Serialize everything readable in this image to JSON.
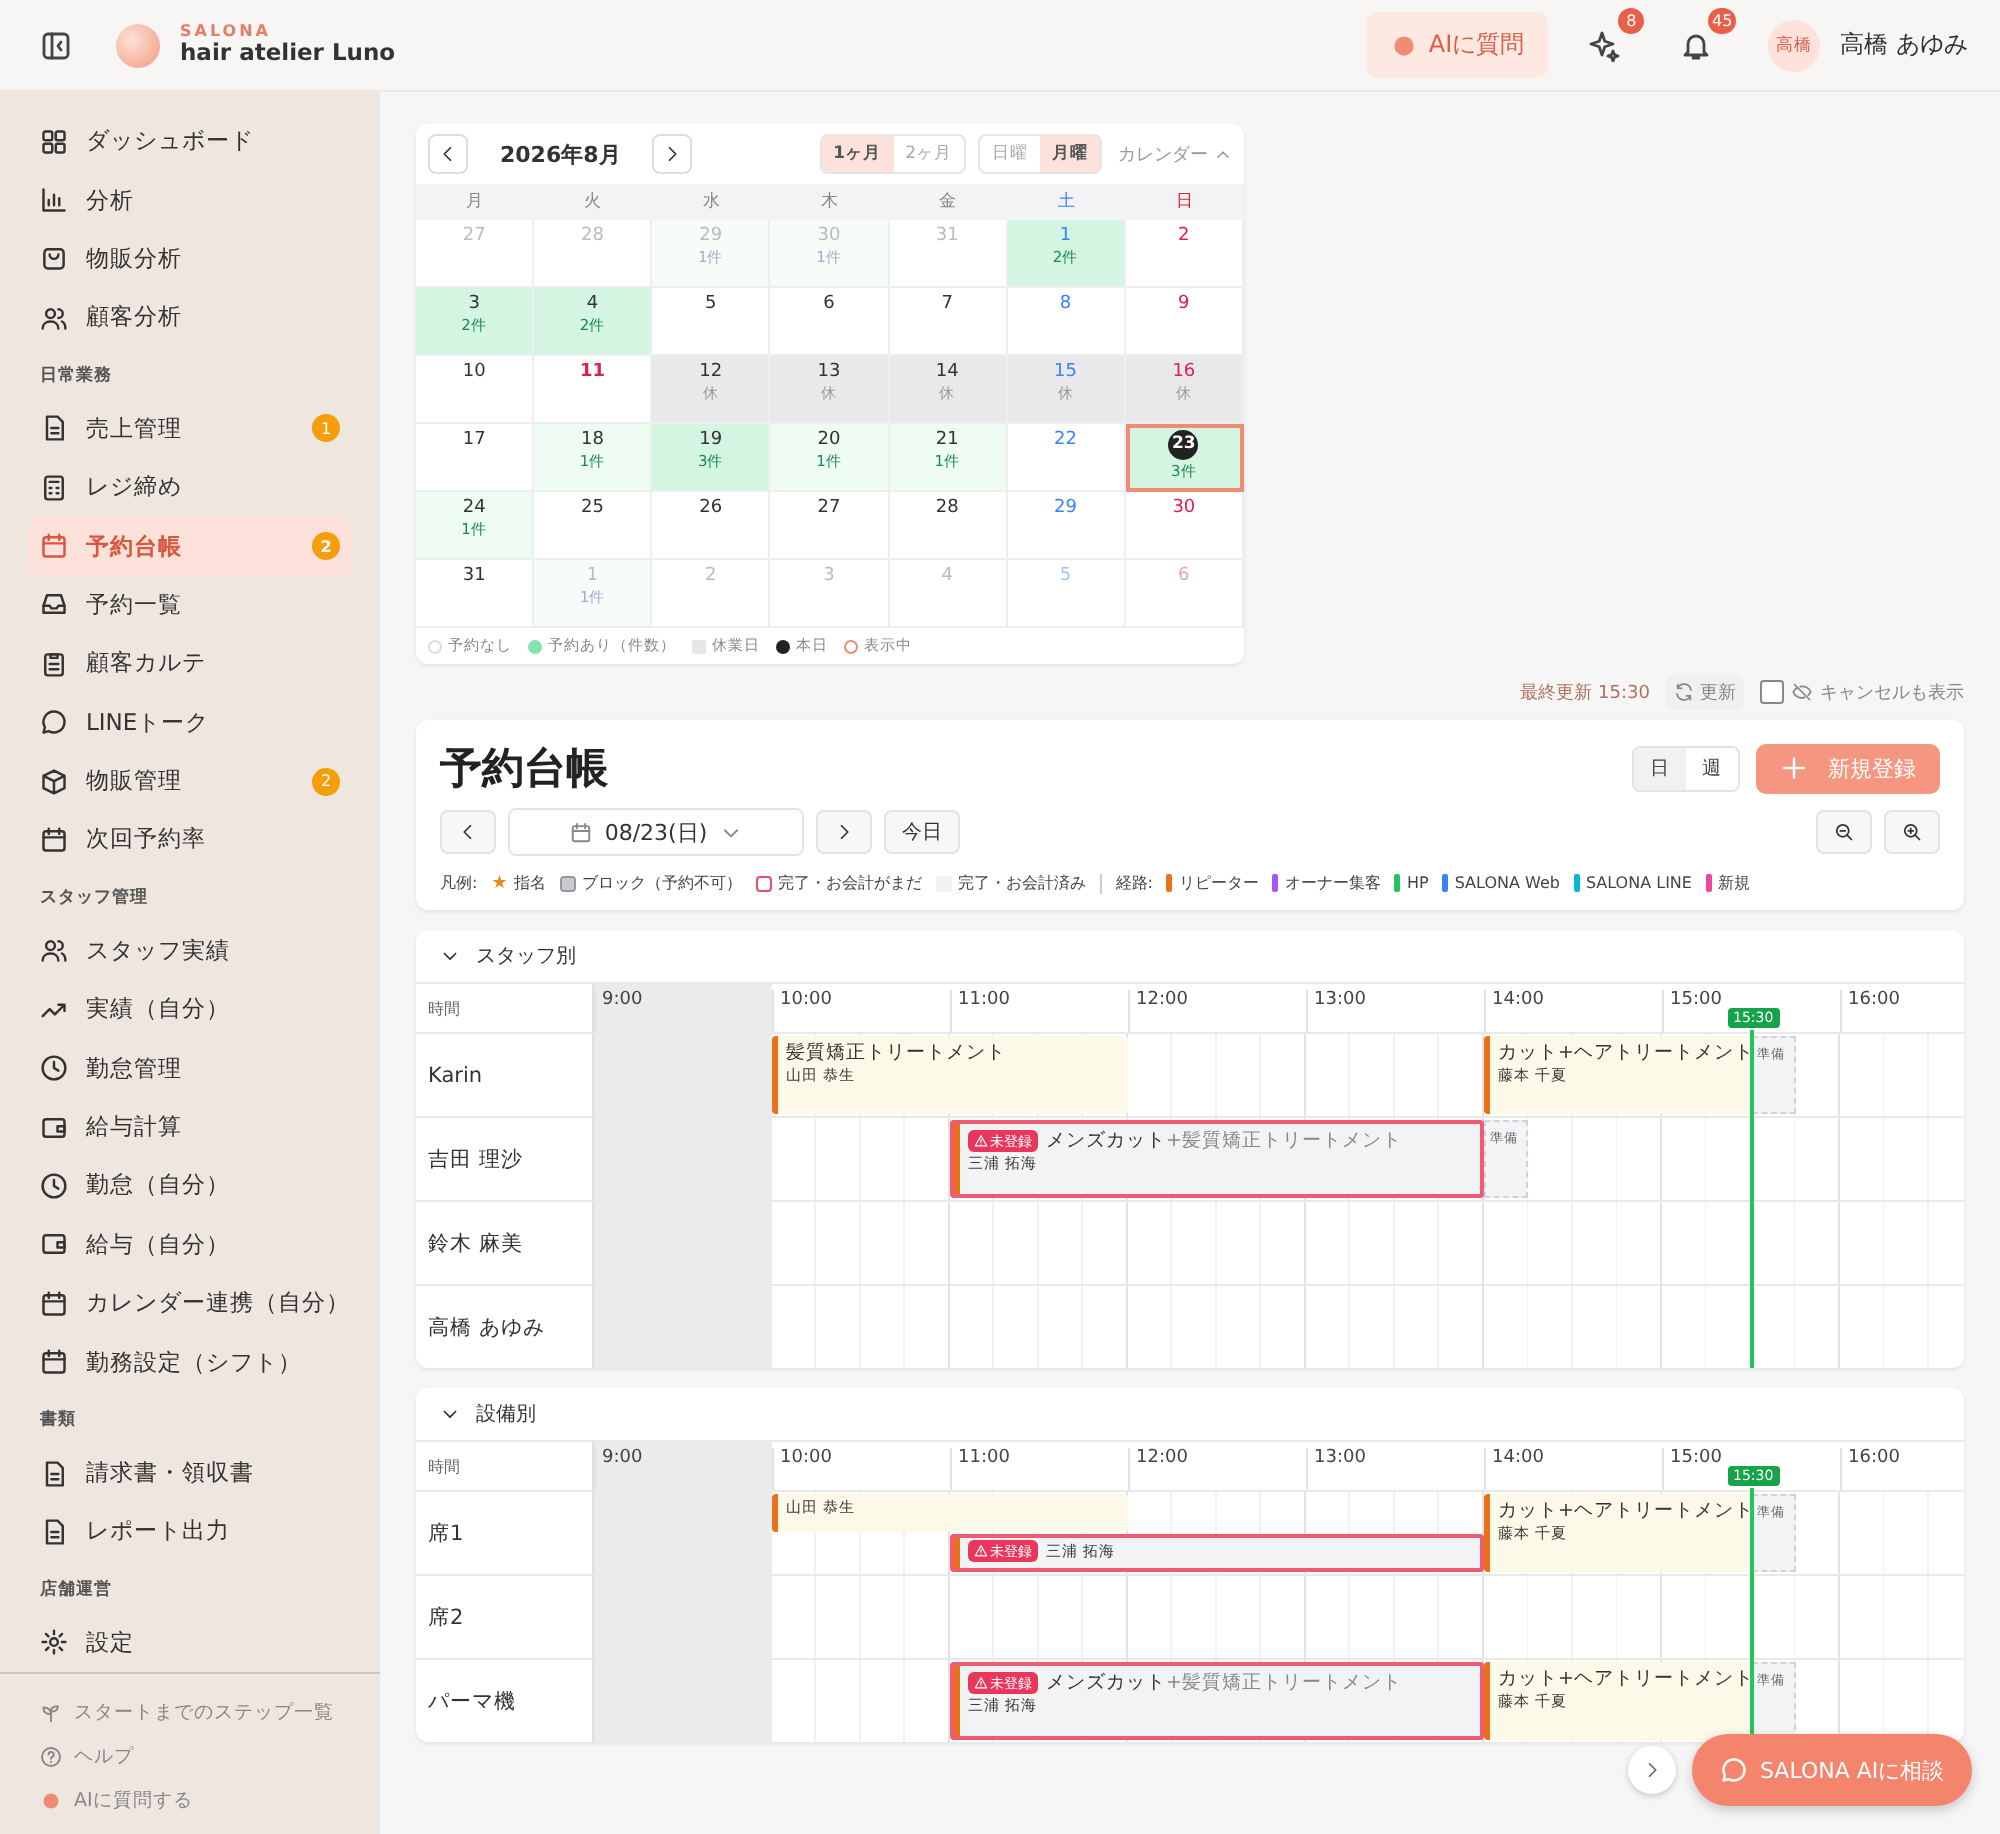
{
  "header": {
    "brand_top": "SALONA",
    "brand_name": "hair atelier Luno",
    "ai_button": "AIに質問",
    "sparkle_badge": "8",
    "bell_badge": "45",
    "avatar": "高橋",
    "user_name": "高橋 あゆみ"
  },
  "sidebar": {
    "sections": [
      {
        "items": [
          {
            "label": "ダッシュボード",
            "selected": false
          },
          {
            "label": "分析",
            "selected": false
          },
          {
            "label": "物販分析",
            "selected": false
          },
          {
            "label": "顧客分析",
            "selected": false
          }
        ]
      },
      {
        "heading": "日常業務",
        "items": [
          {
            "label": "売上管理",
            "selected": false,
            "badge": "1"
          },
          {
            "label": "レジ締め",
            "selected": false
          },
          {
            "label": "予約台帳",
            "selected": true,
            "badge": "2"
          },
          {
            "label": "予約一覧",
            "selected": false
          },
          {
            "label": "顧客カルテ",
            "selected": false
          },
          {
            "label": "LINEトーク",
            "selected": false
          },
          {
            "label": "物販管理",
            "selected": false,
            "badge": "2"
          },
          {
            "label": "次回予約率",
            "selected": false
          }
        ]
      },
      {
        "heading": "スタッフ管理",
        "items": [
          {
            "label": "スタッフ実績",
            "selected": false
          },
          {
            "label": "実績（自分）",
            "selected": false
          },
          {
            "label": "勤怠管理",
            "selected": false
          },
          {
            "label": "給与計算",
            "selected": false
          },
          {
            "label": "勤怠（自分）",
            "selected": false
          },
          {
            "label": "給与（自分）",
            "selected": false
          },
          {
            "label": "カレンダー連携（自分）",
            "selected": false
          },
          {
            "label": "勤務設定（シフト）",
            "selected": false
          }
        ]
      },
      {
        "heading": "書類",
        "items": [
          {
            "label": "請求書・領収書",
            "selected": false
          },
          {
            "label": "レポート出力",
            "selected": false
          }
        ]
      },
      {
        "heading": "店舗運営",
        "items": [
          {
            "label": "設定",
            "selected": false
          }
        ]
      }
    ],
    "footer": [
      "スタートまでのステップ一覧",
      "ヘルプ",
      "AIに質問する"
    ]
  },
  "calendar": {
    "month": "2026年8月",
    "spans": [
      {
        "label": "1ヶ月",
        "selected": true
      },
      {
        "label": "2ヶ月",
        "selected": false
      }
    ],
    "week_starts": [
      {
        "label": "日曜",
        "selected": false
      },
      {
        "label": "月曜",
        "selected": true
      }
    ],
    "toggle": "カレンダー",
    "expanded": true,
    "weekdays": [
      "月",
      "火",
      "水",
      "木",
      "金",
      "土",
      "日"
    ],
    "weeks": [
      {
        "days": [
          {
            "day": "27",
            "kind": "none",
            "outside": true,
            "today": false,
            "selected": false,
            "holiday": false
          },
          {
            "day": "28",
            "kind": "none",
            "outside": true,
            "today": false,
            "selected": false,
            "holiday": false
          },
          {
            "day": "29",
            "note": "1件",
            "kind": "light",
            "outside": true,
            "today": false,
            "selected": false,
            "holiday": false
          },
          {
            "day": "30",
            "note": "1件",
            "kind": "light",
            "outside": true,
            "today": false,
            "selected": false,
            "holiday": false
          },
          {
            "day": "31",
            "kind": "none",
            "outside": true,
            "today": false,
            "selected": false,
            "holiday": false
          },
          {
            "day": "1",
            "note": "2件",
            "kind": "busy",
            "outside": false,
            "today": false,
            "selected": false,
            "holiday": false
          },
          {
            "day": "2",
            "kind": "none",
            "outside": false,
            "today": false,
            "selected": false
          }
        ]
      },
      {
        "days": [
          {
            "day": "3",
            "note": "2件",
            "kind": "busy",
            "outside": false,
            "today": false,
            "selected": false,
            "holiday": false
          },
          {
            "day": "4",
            "note": "2件",
            "kind": "busy",
            "outside": false,
            "today": false,
            "selected": false,
            "holiday": false
          },
          {
            "day": "5",
            "kind": "none",
            "outside": false,
            "today": false,
            "selected": false,
            "holiday": false
          },
          {
            "day": "6",
            "kind": "none",
            "outside": false,
            "today": false,
            "selected": false,
            "holiday": false
          },
          {
            "day": "7",
            "kind": "none",
            "outside": false,
            "today": false,
            "selected": false,
            "holiday": false
          },
          {
            "day": "8",
            "kind": "none",
            "outside": false,
            "today": false,
            "selected": false,
            "holiday": false
          },
          {
            "day": "9",
            "kind": "none",
            "outside": false,
            "today": false,
            "selected": false
          }
        ]
      },
      {
        "days": [
          {
            "day": "10",
            "kind": "none",
            "outside": false,
            "today": false,
            "selected": false,
            "holiday": false
          },
          {
            "day": "11",
            "kind": "none",
            "outside": false,
            "today": false,
            "selected": false,
            "holiday": true
          },
          {
            "day": "12",
            "note": "休",
            "kind": "closed",
            "outside": false,
            "today": false,
            "selected": false,
            "holiday": false
          },
          {
            "day": "13",
            "note": "休",
            "kind": "closed",
            "outside": false,
            "today": false,
            "selected": false,
            "holiday": false
          },
          {
            "day": "14",
            "note": "休",
            "kind": "closed",
            "outside": false,
            "today": false,
            "selected": false,
            "holiday": false
          },
          {
            "day": "15",
            "note": "休",
            "kind": "closed",
            "outside": false,
            "today": false,
            "selected": false,
            "holiday": false
          },
          {
            "day": "16",
            "note": "休",
            "kind": "closed",
            "outside": false,
            "today": false,
            "selected": false
          }
        ]
      },
      {
        "days": [
          {
            "day": "17",
            "kind": "none",
            "outside": false,
            "today": false,
            "selected": false,
            "holiday": false
          },
          {
            "day": "18",
            "note": "1件",
            "kind": "light",
            "outside": false,
            "today": false,
            "selected": false,
            "holiday": false
          },
          {
            "day": "19",
            "note": "3件",
            "kind": "busy",
            "outside": false,
            "today": false,
            "selected": false,
            "holiday": false
          },
          {
            "day": "20",
            "note": "1件",
            "kind": "light",
            "outside": false,
            "today": false,
            "selected": false,
            "holiday": false
          },
          {
            "day": "21",
            "note": "1件",
            "kind": "light",
            "outside": false,
            "today": false,
            "selected": false,
            "holiday": false
          },
          {
            "day": "22",
            "kind": "none",
            "outside": false,
            "today": false,
            "selected": false,
            "holiday": false
          },
          {
            "day": "23",
            "note": "3件",
            "kind": "busy",
            "outside": false,
            "today": true,
            "selected": true
          }
        ]
      },
      {
        "days": [
          {
            "day": "24",
            "note": "1件",
            "kind": "light",
            "outside": false,
            "today": false,
            "selected": false,
            "holiday": false
          },
          {
            "day": "25",
            "kind": "none",
            "outside": false,
            "today": false,
            "selected": false,
            "holiday": false
          },
          {
            "day": "26",
            "kind": "none",
            "outside": false,
            "today": false,
            "selected": false,
            "holiday": false
          },
          {
            "day": "27",
            "kind": "none",
            "outside": false,
            "today": false,
            "selected": false,
            "holiday": false
          },
          {
            "day": "28",
            "kind": "none",
            "outside": false,
            "today": false,
            "selected": false,
            "holiday": false
          },
          {
            "day": "29",
            "kind": "none",
            "outside": false,
            "today": false,
            "selected": false,
            "holiday": false
          },
          {
            "day": "30",
            "kind": "none",
            "outside": false,
            "today": false,
            "selected": false
          }
        ]
      },
      {
        "days": [
          {
            "day": "31",
            "kind": "none",
            "outside": false,
            "today": false,
            "selected": false,
            "holiday": false
          },
          {
            "day": "1",
            "note": "1件",
            "kind": "light",
            "outside": true,
            "today": false,
            "selected": false,
            "holiday": false
          },
          {
            "day": "2",
            "kind": "none",
            "outside": true,
            "today": false,
            "selected": false,
            "holiday": false
          },
          {
            "day": "3",
            "kind": "none",
            "outside": true,
            "today": false,
            "selected": false,
            "holiday": false
          },
          {
            "day": "4",
            "kind": "none",
            "outside": true,
            "today": false,
            "selected": false,
            "holiday": false
          },
          {
            "day": "5",
            "kind": "none",
            "outside": true,
            "today": false,
            "selected": false,
            "holiday": false
          },
          {
            "day": "6",
            "kind": "none",
            "outside": true,
            "today": false,
            "selected": false
          }
        ]
      }
    ],
    "legend": [
      {
        "label": "予約なし",
        "kind": "none"
      },
      {
        "label": "予約あり（件数）",
        "kind": "booked"
      },
      {
        "label": "休業日",
        "kind": "closed"
      },
      {
        "label": "本日",
        "kind": "today"
      },
      {
        "label": "表示中",
        "kind": "selected"
      }
    ]
  },
  "status": {
    "last_updated": "最終更新 15:30",
    "refresh": "更新",
    "show_cancelled": {
      "label": "キャンセルも表示",
      "checked": false
    }
  },
  "ledger": {
    "title": "予約台帳",
    "views": [
      {
        "label": "日",
        "selected": true
      },
      {
        "label": "週",
        "selected": false
      }
    ],
    "new_button": "新規登録",
    "date": "08/23(日)",
    "today_button": "今日",
    "legend_label": "凡例:",
    "legend": [
      {
        "symbol": "★",
        "label": "指名",
        "kind": "star"
      },
      {
        "label": "ブロック（予約不可）",
        "kind": "block"
      },
      {
        "label": "完了・お会計がまだ",
        "kind": "unpaid"
      },
      {
        "label": "完了・お会計済み",
        "kind": "paid"
      }
    ],
    "routes_label": "経路:",
    "routes": [
      {
        "label": "リピーター",
        "color": "#e8711a"
      },
      {
        "label": "オーナー集客",
        "color": "#a855f7"
      },
      {
        "label": "HP",
        "color": "#22c55e"
      },
      {
        "label": "SALONA Web",
        "color": "#3b82f6"
      },
      {
        "label": "SALONA LINE",
        "color": "#06b6d4"
      },
      {
        "label": "新規",
        "color": "#ec4899"
      }
    ]
  },
  "timelines": [
    {
      "title": "スタッフ別",
      "expanded": true,
      "time_header": "時間",
      "hours": [
        {
          "label": "9:00",
          "closed": true
        },
        {
          "label": "10:00",
          "closed": false
        },
        {
          "label": "11:00",
          "closed": false
        },
        {
          "label": "12:00",
          "closed": false
        },
        {
          "label": "13:00",
          "closed": false
        },
        {
          "label": "14:00",
          "closed": false
        },
        {
          "label": "15:00",
          "closed": false
        },
        {
          "label": "16:00",
          "closed": false
        }
      ],
      "now": "15:30",
      "rows": [
        {
          "name": "Karin",
          "lanes": [
            [
              {
                "kind": "free"
              },
              {
                "kind": "free"
              },
              {
                "kind": "free"
              },
              {
                "kind": "free"
              },
              {
                "kind": "service",
                "completed": false,
                "title": "髪質矯正トリートメント",
                "customer": "山田 恭生",
                "color": "#e8711a"
              },
              {
                "kind": "cont"
              },
              {
                "kind": "cont"
              },
              {
                "kind": "cont"
              },
              {
                "kind": "cont"
              },
              {
                "kind": "cont"
              },
              {
                "kind": "cont"
              },
              {
                "kind": "cont"
              },
              {
                "kind": "free"
              },
              {
                "kind": "free"
              },
              {
                "kind": "free"
              },
              {
                "kind": "free"
              },
              {
                "kind": "free"
              },
              {
                "kind": "free"
              },
              {
                "kind": "free"
              },
              {
                "kind": "free"
              },
              {
                "kind": "service",
                "completed": false,
                "title": "カット+ヘアトリートメント",
                "customer": "藤本 千夏",
                "color": "#e8711a"
              },
              {
                "kind": "cont"
              },
              {
                "kind": "cont"
              },
              {
                "kind": "cont"
              },
              {
                "kind": "cont"
              },
              {
                "kind": "cont"
              },
              {
                "kind": "prep",
                "label": "準備"
              },
              {
                "kind": "free"
              },
              {
                "kind": "free"
              },
              {
                "kind": "free"
              },
              {
                "kind": "free"
              }
            ]
          ]
        },
        {
          "name": "吉田 理沙",
          "lanes": [
            [
              {
                "kind": "free"
              },
              {
                "kind": "free"
              },
              {
                "kind": "free"
              },
              {
                "kind": "free"
              },
              {
                "kind": "free"
              },
              {
                "kind": "free"
              },
              {
                "kind": "free"
              },
              {
                "kind": "free"
              },
              {
                "kind": "service",
                "completed": true,
                "paid": false,
                "badge": "未登録",
                "title": "メンズカット",
                "extra": "+髪質矯正トリートメント",
                "customer": "三浦 拓海",
                "color": "#e8711a"
              },
              {
                "kind": "cont"
              },
              {
                "kind": "cont"
              },
              {
                "kind": "cont"
              },
              {
                "kind": "cont"
              },
              {
                "kind": "cont"
              },
              {
                "kind": "cont"
              },
              {
                "kind": "cont"
              },
              {
                "kind": "cont"
              },
              {
                "kind": "cont"
              },
              {
                "kind": "cont"
              },
              {
                "kind": "cont"
              },
              {
                "kind": "prep",
                "label": "準備"
              },
              {
                "kind": "free"
              },
              {
                "kind": "free"
              },
              {
                "kind": "free"
              },
              {
                "kind": "free"
              },
              {
                "kind": "free"
              },
              {
                "kind": "free"
              },
              {
                "kind": "free"
              },
              {
                "kind": "free"
              },
              {
                "kind": "free"
              },
              {
                "kind": "free"
              }
            ]
          ]
        },
        {
          "name": "鈴木 麻美",
          "lanes": []
        },
        {
          "name": "高橋 あゆみ",
          "lanes": []
        }
      ]
    },
    {
      "title": "設備別",
      "expanded": true,
      "time_header": "時間",
      "hours": [
        {
          "label": "9:00",
          "closed": true
        },
        {
          "label": "10:00",
          "closed": false
        },
        {
          "label": "11:00",
          "closed": false
        },
        {
          "label": "12:00",
          "closed": false
        },
        {
          "label": "13:00",
          "closed": false
        },
        {
          "label": "14:00",
          "closed": false
        },
        {
          "label": "15:00",
          "closed": false
        },
        {
          "label": "16:00",
          "closed": false
        }
      ],
      "now": "15:30",
      "rows": [
        {
          "name": "席1",
          "lanes": [
            [
              {
                "kind": "free"
              },
              {
                "kind": "free"
              },
              {
                "kind": "free"
              },
              {
                "kind": "free"
              },
              {
                "kind": "service-top",
                "completed": false,
                "customer": "山田 恭生",
                "color": "#e8711a"
              },
              {
                "kind": "cont"
              },
              {
                "kind": "cont"
              },
              {
                "kind": "cont"
              },
              {
                "kind": "cont"
              },
              {
                "kind": "cont"
              },
              {
                "kind": "cont"
              },
              {
                "kind": "cont"
              },
              {
                "kind": "free"
              },
              {
                "kind": "free"
              },
              {
                "kind": "free"
              },
              {
                "kind": "free"
              },
              {
                "kind": "free"
              },
              {
                "kind": "free"
              },
              {
                "kind": "free"
              },
              {
                "kind": "free"
              },
              {
                "kind": "service",
                "completed": false,
                "title": "カット+ヘアトリートメント",
                "customer": "藤本 千夏",
                "color": "#e8711a"
              },
              {
                "kind": "cont"
              },
              {
                "kind": "cont"
              },
              {
                "kind": "cont"
              },
              {
                "kind": "cont"
              },
              {
                "kind": "cont"
              },
              {
                "kind": "prep",
                "label": "準備"
              },
              {
                "kind": "free"
              },
              {
                "kind": "free"
              },
              {
                "kind": "free"
              },
              {
                "kind": "free"
              }
            ],
            [
              {
                "kind": "free"
              },
              {
                "kind": "free"
              },
              {
                "kind": "free"
              },
              {
                "kind": "free"
              },
              {
                "kind": "free"
              },
              {
                "kind": "free"
              },
              {
                "kind": "free"
              },
              {
                "kind": "free"
              },
              {
                "kind": "service-bottom",
                "completed": true,
                "paid": false,
                "badge": "未登録",
                "customer": "三浦 拓海",
                "color": "#e8711a"
              },
              {
                "kind": "cont"
              },
              {
                "kind": "cont"
              },
              {
                "kind": "cont"
              },
              {
                "kind": "cont"
              },
              {
                "kind": "cont"
              },
              {
                "kind": "cont"
              },
              {
                "kind": "cont"
              },
              {
                "kind": "cont"
              },
              {
                "kind": "cont"
              },
              {
                "kind": "cont"
              },
              {
                "kind": "cont"
              },
              {
                "kind": "free"
              },
              {
                "kind": "free"
              },
              {
                "kind": "free"
              },
              {
                "kind": "free"
              },
              {
                "kind": "free"
              },
              {
                "kind": "free"
              },
              {
                "kind": "free"
              },
              {
                "kind": "free"
              },
              {
                "kind": "free"
              },
              {
                "kind": "free"
              },
              {
                "kind": "free"
              }
            ]
          ]
        },
        {
          "name": "席2",
          "lanes": []
        },
        {
          "name": "パーマ機",
          "lanes": [
            [
              {
                "kind": "free"
              },
              {
                "kind": "free"
              },
              {
                "kind": "free"
              },
              {
                "kind": "free"
              },
              {
                "kind": "free"
              },
              {
                "kind": "free"
              },
              {
                "kind": "free"
              },
              {
                "kind": "free"
              },
              {
                "kind": "service",
                "completed": true,
                "paid": false,
                "badge": "未登録",
                "title": "メンズカット",
                "extra": "+髪質矯正トリートメント",
                "customer": "三浦 拓海",
                "color": "#e8711a"
              },
              {
                "kind": "cont"
              },
              {
                "kind": "cont"
              },
              {
                "kind": "cont"
              },
              {
                "kind": "cont"
              },
              {
                "kind": "cont"
              },
              {
                "kind": "cont"
              },
              {
                "kind": "cont"
              },
              {
                "kind": "cont"
              },
              {
                "kind": "cont"
              },
              {
                "kind": "cont"
              },
              {
                "kind": "cont"
              },
              {
                "kind": "service",
                "completed": false,
                "title": "カット+ヘアトリートメント",
                "customer": "藤本 千夏",
                "color": "#e8711a"
              },
              {
                "kind": "cont"
              },
              {
                "kind": "cont"
              },
              {
                "kind": "cont"
              },
              {
                "kind": "cont"
              },
              {
                "kind": "cont"
              },
              {
                "kind": "prep",
                "label": "準備"
              },
              {
                "kind": "free"
              },
              {
                "kind": "free"
              },
              {
                "kind": "free"
              },
              {
                "kind": "free"
              }
            ]
          ]
        }
      ]
    }
  ],
  "chat_button": "SALONA AIに相談"
}
